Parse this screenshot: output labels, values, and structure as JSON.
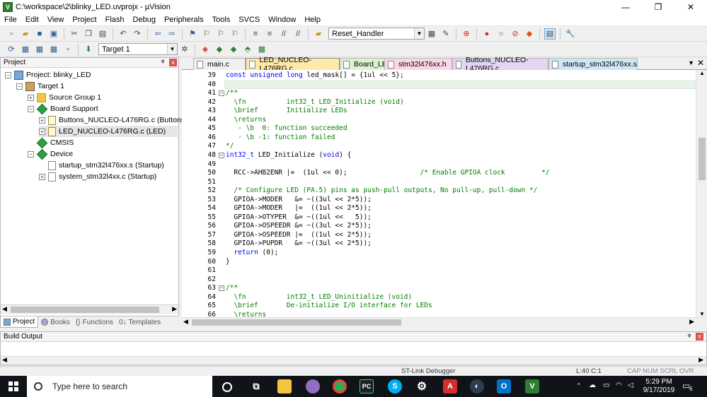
{
  "window": {
    "title": "C:\\workspace\\2\\blinky_LED.uvprojx - µVision",
    "min": "—",
    "max": "❐",
    "close": "✕"
  },
  "menu": [
    "File",
    "Edit",
    "View",
    "Project",
    "Flash",
    "Debug",
    "Peripherals",
    "Tools",
    "SVCS",
    "Window",
    "Help"
  ],
  "toolbar": {
    "function_combo": "Reset_Handler",
    "target_combo": "Target 1"
  },
  "project_panel": {
    "title": "Project",
    "pin": "ᵠ",
    "close": "x",
    "tree": [
      {
        "label": "Project: blinky_LED"
      },
      {
        "label": "Target 1"
      },
      {
        "label": "Source Group 1"
      },
      {
        "label": "Board Support"
      },
      {
        "label": "Buttons_NUCLEO-L476RG.c (Buttons)"
      },
      {
        "label": "LED_NUCLEO-L476RG.c (LED)"
      },
      {
        "label": "CMSIS"
      },
      {
        "label": "Device"
      },
      {
        "label": "startup_stm32l476xx.s (Startup)"
      },
      {
        "label": "system_stm32l4xx.c (Startup)"
      }
    ],
    "tabs": [
      "Project",
      "Books",
      "Functions",
      "Templates"
    ]
  },
  "editor": {
    "tabs": [
      {
        "label": "main.c",
        "color": "#f0f0f0"
      },
      {
        "label": "LED_NUCLEO-L476RG.c",
        "color": "#fde9a9"
      },
      {
        "label": "Board_LED.h",
        "color": "#d9f2d0"
      },
      {
        "label": "stm32l476xx.h",
        "color": "#f9d6e8"
      },
      {
        "label": "Buttons_NUCLEO-L476RG.c",
        "color": "#e2d6f2"
      },
      {
        "label": "startup_stm32l476xx.s",
        "color": "#cfe6f5"
      }
    ],
    "lines": [
      {
        "n": "39",
        "t": "const unsigned long led_mask[] = {1ul << 5};"
      },
      {
        "n": "40",
        "t": ""
      },
      {
        "n": "41",
        "t": "/**"
      },
      {
        "n": "42",
        "t": "  \\fn          int32_t LED_Initialize (void)"
      },
      {
        "n": "43",
        "t": "  \\brief       Initialize LEDs"
      },
      {
        "n": "44",
        "t": "  \\returns"
      },
      {
        "n": "45",
        "t": "   - \\b  0: function succeeded"
      },
      {
        "n": "46",
        "t": "   - \\b -1: function failed"
      },
      {
        "n": "47",
        "t": "*/"
      },
      {
        "n": "48",
        "t": "int32_t LED_Initialize (void) {"
      },
      {
        "n": "49",
        "t": ""
      },
      {
        "n": "50",
        "t": "  RCC->AHB2ENR |=  (1ul << 0);                  /* Enable GPIOA clock         */"
      },
      {
        "n": "51",
        "t": ""
      },
      {
        "n": "52",
        "t": "  /* Configure LED (PA.5) pins as push-pull outputs, No pull-up, pull-down */"
      },
      {
        "n": "53",
        "t": "  GPIOA->MODER   &= ~((3ul << 2*5));"
      },
      {
        "n": "54",
        "t": "  GPIOA->MODER   |=  ((1ul << 2*5));"
      },
      {
        "n": "55",
        "t": "  GPIOA->OTYPER  &= ~((1ul <<   5));"
      },
      {
        "n": "56",
        "t": "  GPIOA->OSPEEDR &= ~((3ul << 2*5));"
      },
      {
        "n": "57",
        "t": "  GPIOA->OSPEEDR |=  ((1ul << 2*5));"
      },
      {
        "n": "58",
        "t": "  GPIOA->PUPDR   &= ~((3ul << 2*5));"
      },
      {
        "n": "59",
        "t": "  return (0);"
      },
      {
        "n": "60",
        "t": "}"
      },
      {
        "n": "61",
        "t": ""
      },
      {
        "n": "62",
        "t": ""
      },
      {
        "n": "63",
        "t": "/**"
      },
      {
        "n": "64",
        "t": "  \\fn          int32_t LED_Uninitialize (void)"
      },
      {
        "n": "65",
        "t": "  \\brief       De-initialize I/O interface for LEDs"
      },
      {
        "n": "66",
        "t": "  \\returns"
      }
    ]
  },
  "build_output": {
    "title": "Build Output"
  },
  "status": {
    "debugger": "ST-Link Debugger",
    "position": "L:40 C:1",
    "flags": "CAP  NUM  SCRL  OVR  R/O"
  },
  "taskbar": {
    "search_placeholder": "Type here to search",
    "time": "5:29 PM",
    "date": "9/17/2019",
    "notif_count": "6"
  }
}
